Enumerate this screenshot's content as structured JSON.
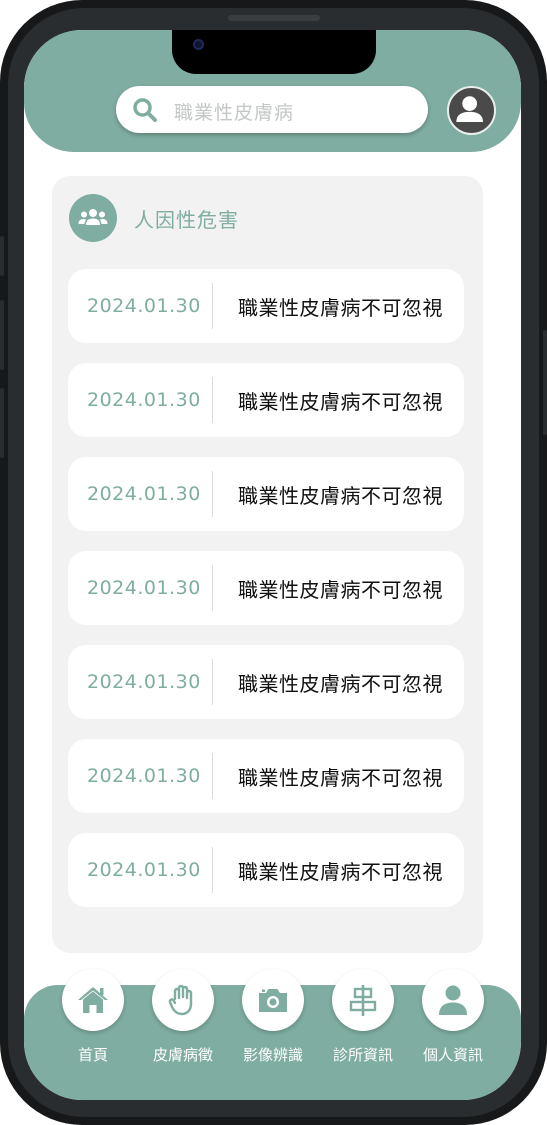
{
  "search": {
    "placeholder": "職業性皮膚病"
  },
  "section": {
    "title": "人因性危害"
  },
  "articles": [
    {
      "date": "2024.01.30",
      "title": "職業性皮膚病不可忽視"
    },
    {
      "date": "2024.01.30",
      "title": "職業性皮膚病不可忽視"
    },
    {
      "date": "2024.01.30",
      "title": "職業性皮膚病不可忽視"
    },
    {
      "date": "2024.01.30",
      "title": "職業性皮膚病不可忽視"
    },
    {
      "date": "2024.01.30",
      "title": "職業性皮膚病不可忽視"
    },
    {
      "date": "2024.01.30",
      "title": "職業性皮膚病不可忽視"
    },
    {
      "date": "2024.01.30",
      "title": "職業性皮膚病不可忽視"
    }
  ],
  "nav": {
    "items": [
      {
        "label": "首頁",
        "icon": "home-icon"
      },
      {
        "label": "皮膚病徵",
        "icon": "hand-icon"
      },
      {
        "label": "影像辨識",
        "icon": "camera-icon"
      },
      {
        "label": "診所資訊",
        "icon": "signpost-icon"
      },
      {
        "label": "個人資訊",
        "icon": "person-icon"
      }
    ]
  },
  "colors": {
    "accent": "#7fada1",
    "card": "#f2f2f2",
    "text": "#111111"
  }
}
